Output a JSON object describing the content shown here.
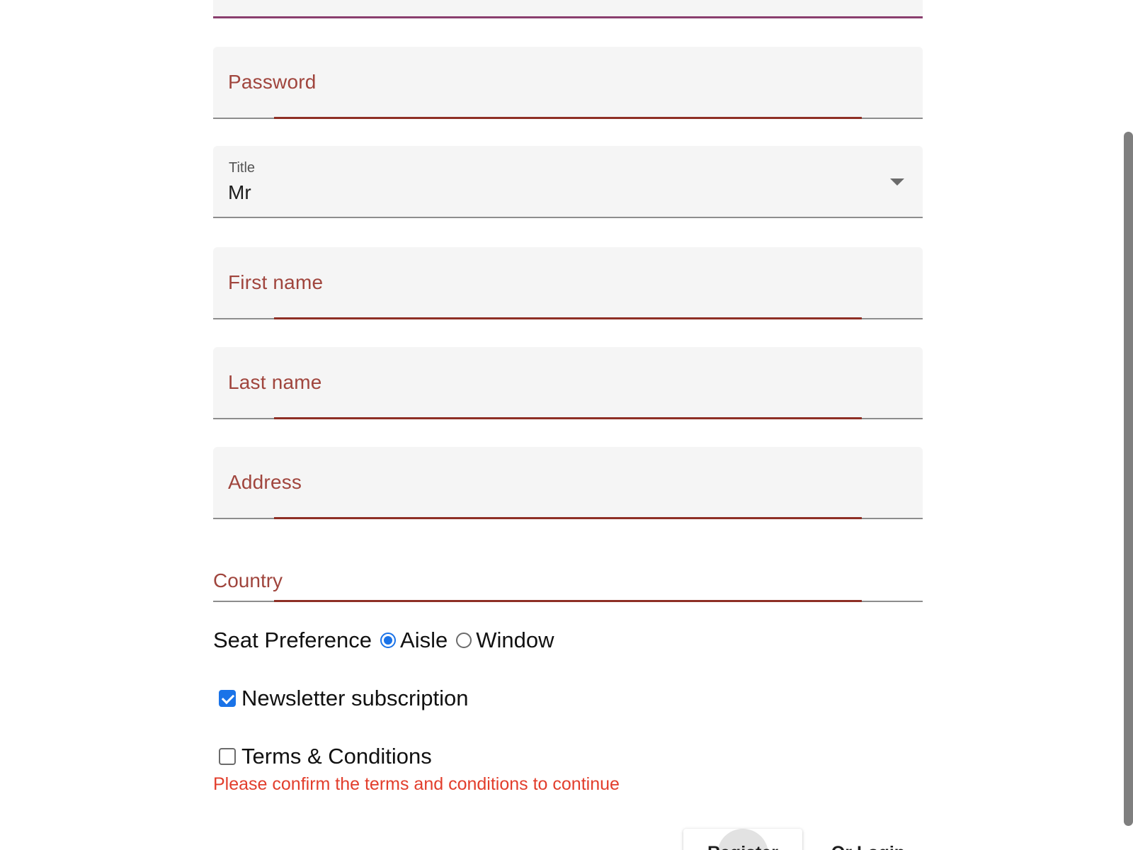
{
  "form": {
    "password": {
      "placeholder": "Password"
    },
    "title": {
      "label": "Title",
      "value": "Mr"
    },
    "first_name": {
      "placeholder": "First name"
    },
    "last_name": {
      "placeholder": "Last name"
    },
    "address": {
      "placeholder": "Address"
    },
    "country": {
      "placeholder": "Country"
    },
    "seat_preference": {
      "label": "Seat Preference",
      "options": [
        {
          "label": "Aisle",
          "selected": true
        },
        {
          "label": "Window",
          "selected": false
        }
      ]
    },
    "newsletter": {
      "label": "Newsletter subscription",
      "checked": true
    },
    "terms": {
      "label": "Terms & Conditions",
      "checked": false
    },
    "terms_error": "Please confirm the terms and conditions to continue",
    "register_label": "Register",
    "login_label": "Or Login"
  },
  "colors": {
    "error": "#e23e2c",
    "placeholder": "#a0453d",
    "accent": "#1a73e8",
    "focus_line": "#8a3f6e"
  }
}
